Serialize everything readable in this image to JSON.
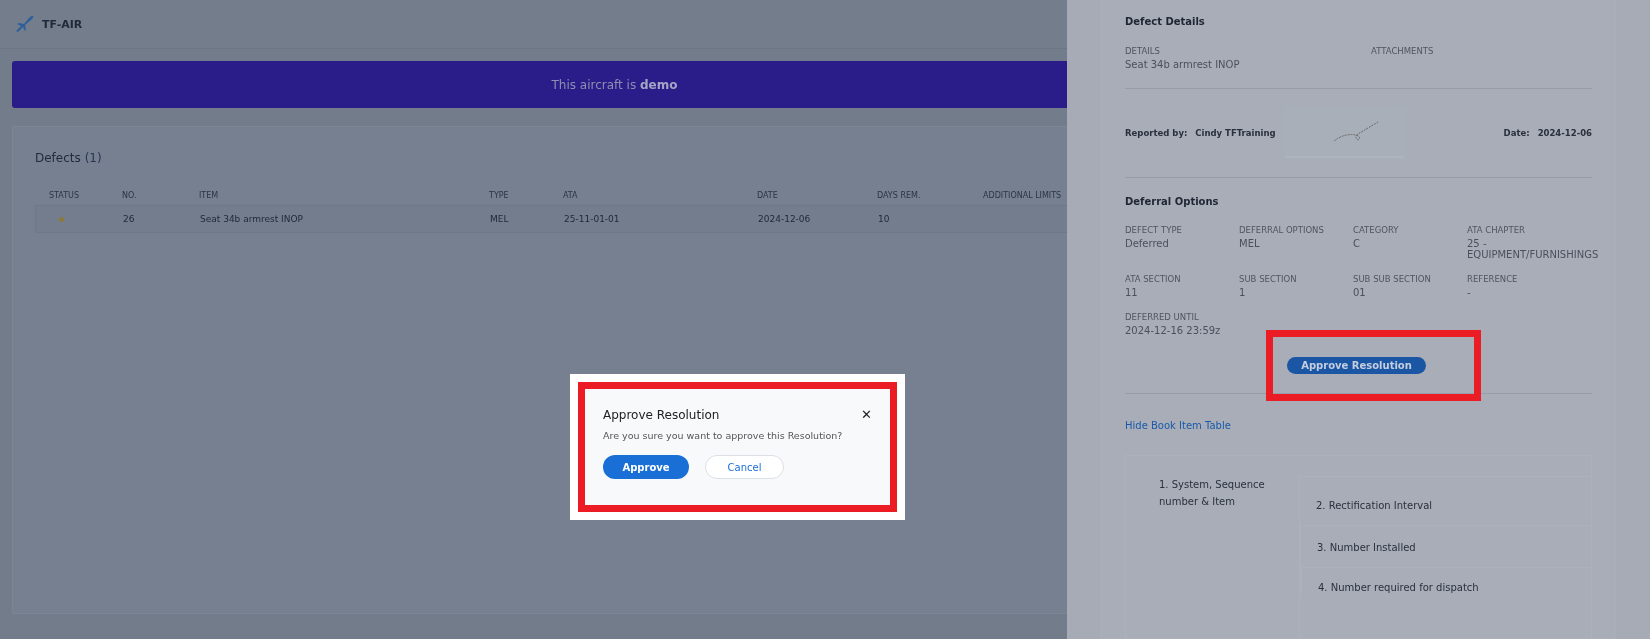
{
  "header": {
    "title": "TF-AIR"
  },
  "banner": {
    "text": "This aircraft is **demo**"
  },
  "defects": {
    "title": "Defects",
    "count": "(1)",
    "columns": [
      "STATUS",
      "NO.",
      "ITEM",
      "TYPE",
      "ATA",
      "DATE",
      "DAYS REM.",
      "ADDITIONAL LIMITS"
    ],
    "rows": [
      {
        "color": "#8a7a3a",
        "no": "26",
        "item": "Seat 34b armrest INOP",
        "type": "MEL",
        "ata": "25-11-01-01",
        "date": "2024-12-06",
        "days_rem": "10"
      }
    ]
  },
  "panel": {
    "defect_details": {
      "title": "Defect Details",
      "fields": [
        {
          "label": "DETAILS",
          "value": "Seat 34b armrest INOP"
        },
        {
          "label": "ATTACHMENTS"
        }
      ]
    },
    "reported_by_label": "Reported by:",
    "reported_by": "Cindy TFTraining",
    "date_label": "Date:",
    "date": "2024-12-06",
    "deferral": {
      "title": "Deferral Options",
      "fields": [
        {
          "label": "DEFECT TYPE",
          "value": "Deferred"
        },
        {
          "label": "DEFERRAL OPTIONS",
          "value": "MEL"
        },
        {
          "label": "CATEGORY",
          "value": "C"
        },
        {
          "label": "ATA CHAPTER",
          "value": "25 - EQUIPMENT/FURNISHINGS"
        },
        {
          "label": "ATA SECTION",
          "value": "11"
        },
        {
          "label": "SUB SECTION",
          "value": "1"
        },
        {
          "label": "SUB SUB SECTION",
          "value": "01"
        },
        {
          "label": "REFERENCE",
          "value": "-"
        },
        {
          "label": "DEFERRED UNTIL",
          "value": "2024-12-16 23:59z"
        }
      ]
    },
    "approve_button": "Approve Resolution",
    "hide_link": "Hide Book Item Table",
    "book_items": [
      "1. System, Sequence number & Item",
      "2. Rectification Interval",
      "3. Number Installed",
      "4. Number required for dispatch"
    ]
  },
  "dialog": {
    "title": "Approve Resolution",
    "message": "Are you sure you want to approve this Resolution?",
    "close": "✕",
    "buttons": [
      {
        "label": "Approve",
        "kind": "primary"
      },
      {
        "label": "Cancel",
        "kind": "secondary"
      }
    ]
  }
}
